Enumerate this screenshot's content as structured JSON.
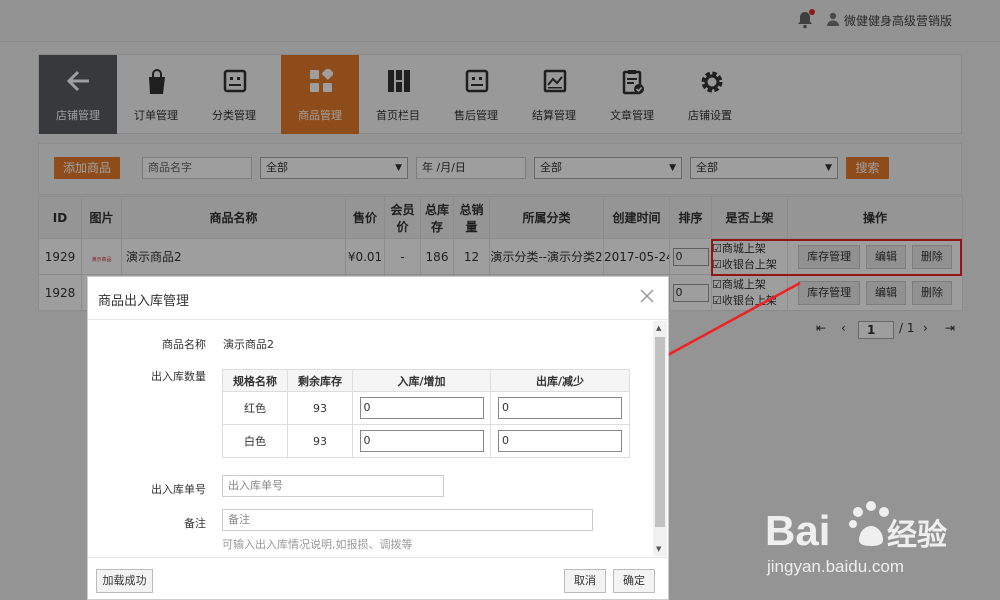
{
  "header": {
    "user_name": "微健健身高级营销版"
  },
  "nav": [
    {
      "label": "店铺管理",
      "icon": "back-arrow-icon"
    },
    {
      "label": "订单管理",
      "icon": "shopping-bag-icon"
    },
    {
      "label": "分类管理",
      "icon": "category-box-icon"
    },
    {
      "label": "商品管理",
      "icon": "products-grid-icon"
    },
    {
      "label": "首页栏目",
      "icon": "columns-icon"
    },
    {
      "label": "售后管理",
      "icon": "aftersale-box-icon"
    },
    {
      "label": "结算管理",
      "icon": "settlement-chart-icon"
    },
    {
      "label": "文章管理",
      "icon": "article-clipboard-icon"
    },
    {
      "label": "店铺设置",
      "icon": "gear-icon"
    }
  ],
  "filter": {
    "add_label": "添加商品",
    "name_placeholder": "商品名字",
    "select1": "全部",
    "date_placeholder": "年 /月/日",
    "select2": "全部",
    "select3": "全部",
    "search_label": "搜索"
  },
  "table": {
    "headers": [
      "ID",
      "图片",
      "商品名称",
      "售价",
      "会员价",
      "总库存",
      "总销量",
      "所属分类",
      "创建时间",
      "排序",
      "是否上架",
      "操作"
    ],
    "rows": [
      {
        "id": "1929",
        "thumb": "演示商品",
        "name": "演示商品2",
        "price": "¥0.01",
        "member_price": "-",
        "stock": "186",
        "sales": "12",
        "category": "演示分类--演示分类2",
        "created": "2017-05-24",
        "sort": "0",
        "shelf1": "☑商城上架",
        "shelf2": "☑收银台上架"
      },
      {
        "id": "1928",
        "thumb": "",
        "name": "",
        "price": "",
        "member_price": "",
        "stock": "",
        "sales": "",
        "category": "",
        "created": "",
        "sort": "0",
        "shelf1": "☑商城上架",
        "shelf2": "☑收银台上架"
      }
    ],
    "ops": {
      "stock": "库存管理",
      "edit": "编辑",
      "delete": "删除"
    }
  },
  "pager": {
    "page": "1",
    "total": "/ 1"
  },
  "modal": {
    "title": "商品出入库管理",
    "name_label": "商品名称",
    "name_value": "演示商品2",
    "qty_label": "出入库数量",
    "stock_headers": [
      "规格名称",
      "剩余库存",
      "入库/增加",
      "出库/减少"
    ],
    "stock_rows": [
      {
        "spec": "红色",
        "remain": "93",
        "in": "0",
        "out": "0"
      },
      {
        "spec": "白色",
        "remain": "93",
        "in": "0",
        "out": "0"
      }
    ],
    "order_label": "出入库单号",
    "order_placeholder": "出入库单号",
    "note_label": "备注",
    "note_placeholder": "备注",
    "hint": "可输入出入库情况说明,如报损、调拨等",
    "status": "加载成功",
    "cancel": "取消",
    "confirm": "确定"
  },
  "watermark": {
    "brand_left": "Bai",
    "brand_right": "经验",
    "url": "jingyan.baidu.com"
  },
  "colors": {
    "accent": "#e77b2c",
    "nav_back": "#5a5d63",
    "highlight": "#e22222"
  }
}
